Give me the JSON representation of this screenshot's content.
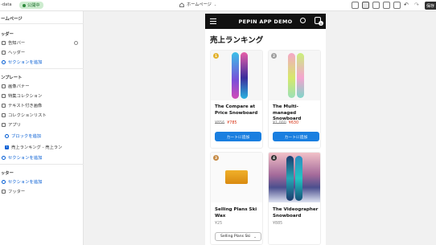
{
  "topbar": {
    "app_name": "-data",
    "status": "公開中",
    "page": "ホームページ",
    "save_label": "保存"
  },
  "sidebar": {
    "title": "ームページ",
    "header_section": "ッダー",
    "header_items": [
      "告知バー",
      "ヘッダー"
    ],
    "header_add": "セクションを追加",
    "template_section": "ンプレート",
    "template_items": [
      "画像バナー",
      "特集コレクション",
      "テキスト付き画像",
      "コレクションリスト",
      "アプリ"
    ],
    "block_add": "ブロックを追加",
    "app_block": "売上ランキング - 売上ラン",
    "app_block_num": "5",
    "template_add": "セクションを追加",
    "footer_section": "ッター",
    "footer_add": "セクションを追加",
    "footer_item": "フッター"
  },
  "preview": {
    "brand": "PEPIN APP DEMO",
    "cart_count": "5",
    "heading": "売上ランキング",
    "products": [
      {
        "rank": "1",
        "rank_color": "#e2b22c",
        "name": "The Compare at Price Snowboard",
        "compare_price": "¥856",
        "price": "¥785",
        "button": "カートに追加"
      },
      {
        "rank": "2",
        "rank_color": "#9e9e9e",
        "name": "The Multi-managed Snowboard",
        "compare_price": "¥1,000",
        "price": "¥630",
        "button": "カートに追加"
      },
      {
        "rank": "3",
        "rank_color": "#c58a45",
        "name": "Selling Plans Ski Wax",
        "price": "¥25",
        "select_value": "Selling Plans Ski"
      },
      {
        "rank": "4",
        "rank_color": "#333333",
        "name": "The Videographer Snowboard",
        "price": "¥885"
      }
    ]
  },
  "colors": {
    "accent": "#005bd3",
    "cart_button": "#1a7fe0",
    "sale": "#d72c0d",
    "status_bg": "#cdeccf"
  }
}
